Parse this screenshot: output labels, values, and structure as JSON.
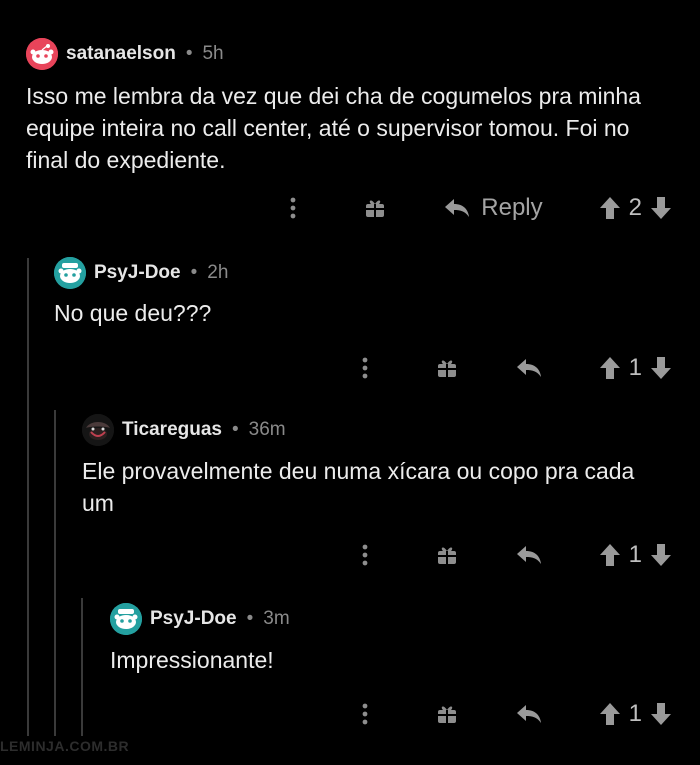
{
  "comments": [
    {
      "username": "satanaelson",
      "age": "5h",
      "body": "Isso me lembra da vez que dei cha de cogumelos pra minha equipe inteira no call center, até o supervisor tomou. Foi no final do expediente.",
      "reply_label": "Reply",
      "votes": "2"
    },
    {
      "username": "PsyJ-Doe",
      "age": "2h",
      "body": "No que deu???",
      "votes": "1"
    },
    {
      "username": "Ticareguas",
      "age": "36m",
      "body": "Ele provavelmente deu numa xícara ou copo pra cada um",
      "votes": "1"
    },
    {
      "username": "PsyJ-Doe",
      "age": "3m",
      "body": "Impressionante!",
      "votes": "1"
    }
  ],
  "separator": "•",
  "watermark": "LEMINJA.COM.BR",
  "colors": {
    "background": "#000000",
    "text": "#e6e6e6",
    "muted": "#8a8a8a",
    "thread_line": "#3a3a3a",
    "avatar_red": "#e8445a",
    "avatar_teal": "#24a0a0"
  }
}
